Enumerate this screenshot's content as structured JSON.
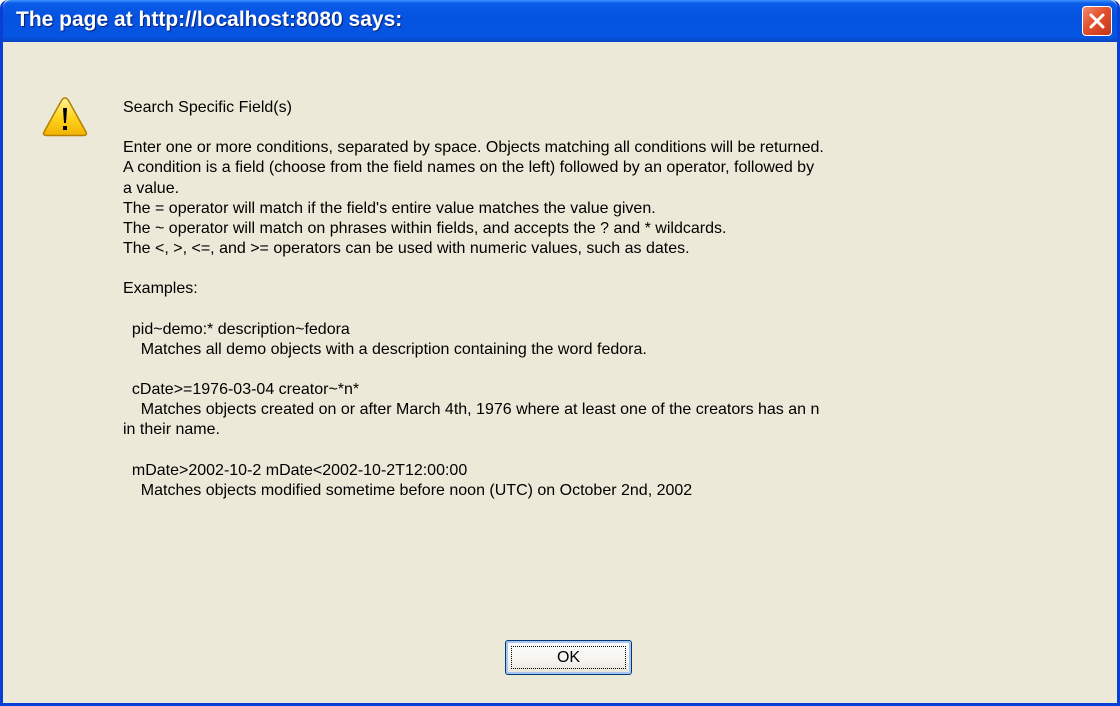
{
  "window": {
    "title": "The page at http://localhost:8080 says:"
  },
  "icons": {
    "warning": "warning-triangle-icon",
    "close": "close-x-icon"
  },
  "colors": {
    "titlebar": "#0553e1",
    "close_button": "#e2512c",
    "dialog_background": "#ece9d8",
    "warning_fill": "#ffd520"
  },
  "message": {
    "heading": "Search Specific Field(s)",
    "intro_lines": [
      "Enter one or more conditions, separated by space.  Objects matching all conditions will be returned.",
      "A condition is a field (choose from the field names on the left) followed by an operator, followed by",
      "a value.",
      "The = operator will match if the field's entire value matches the value given.",
      "The ~ operator will match on phrases within fields, and accepts the ? and * wildcards.",
      "The <, >, <=, and >= operators can be used with numeric values, such as dates."
    ],
    "examples_label": "Examples:",
    "examples": [
      {
        "query": "  pid~demo:* description~fedora",
        "description_lines": [
          "    Matches all demo objects with a description containing the word fedora."
        ]
      },
      {
        "query": "  cDate>=1976-03-04 creator~*n*",
        "description_lines": [
          "    Matches objects created on or after March 4th, 1976 where at least one of the creators has an n",
          "in their name."
        ]
      },
      {
        "query": "  mDate>2002-10-2 mDate<2002-10-2T12:00:00",
        "description_lines": [
          "    Matches objects modified sometime before noon (UTC) on October 2nd, 2002"
        ]
      }
    ]
  },
  "buttons": {
    "ok_label": "OK"
  }
}
